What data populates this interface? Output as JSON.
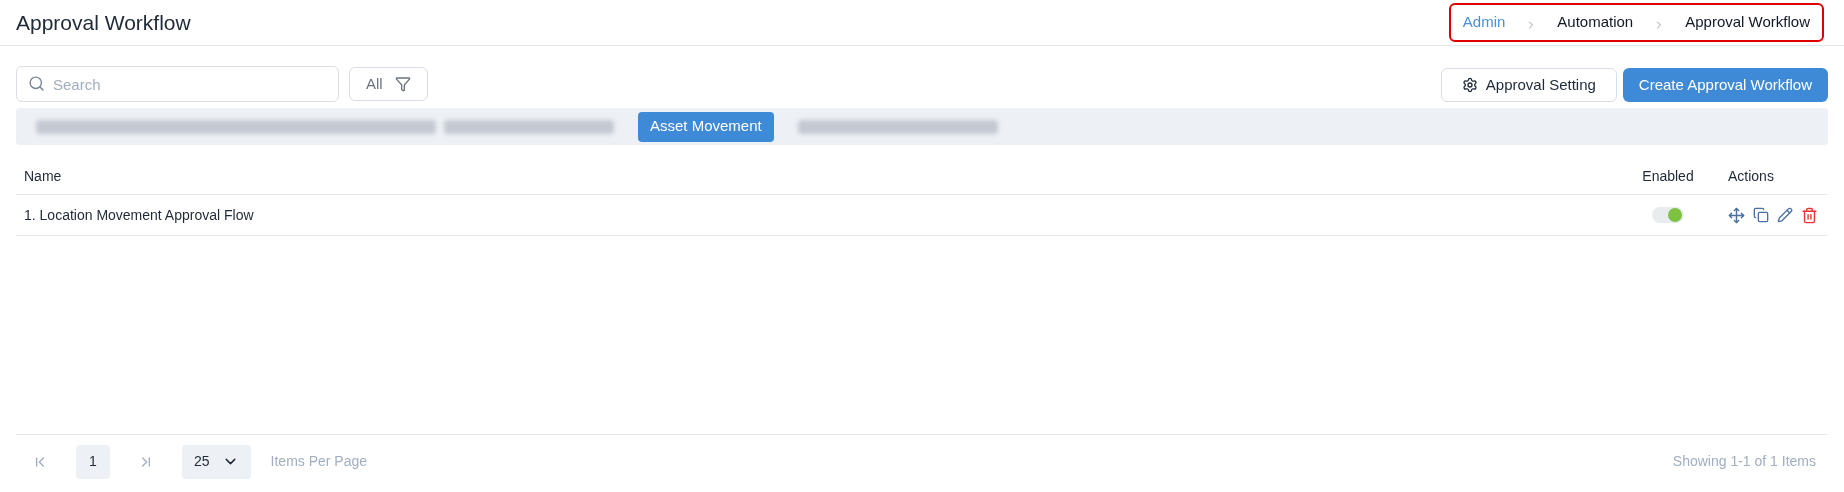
{
  "page_title": "Approval Workflow",
  "breadcrumb": [
    {
      "label": "Admin",
      "kind": "link"
    },
    {
      "label": "Automation",
      "kind": "text"
    },
    {
      "label": "Approval Workflow",
      "kind": "text"
    }
  ],
  "search": {
    "placeholder": "Search"
  },
  "filter": {
    "label": "All"
  },
  "buttons": [
    {
      "label": "Approval Setting",
      "kind": "secondary"
    },
    {
      "label": "Create Approval Workflow",
      "kind": "primary"
    }
  ],
  "tabs": [
    {
      "kind": "redacted",
      "selected": false
    },
    {
      "kind": "redacted",
      "selected": false
    },
    {
      "kind": "text",
      "label": "Asset Movement",
      "selected": true
    },
    {
      "kind": "redacted",
      "selected": false
    }
  ],
  "table": {
    "columns": [
      "Name",
      "Enabled",
      "Actions"
    ],
    "rows": [
      {
        "name": "1. Location Movement Approval Flow",
        "enabled": true
      }
    ]
  },
  "pagination": {
    "page": "1",
    "page_size": "25",
    "page_size_label": "Items Per Page",
    "summary": "Showing 1-1 of 1 Items"
  }
}
